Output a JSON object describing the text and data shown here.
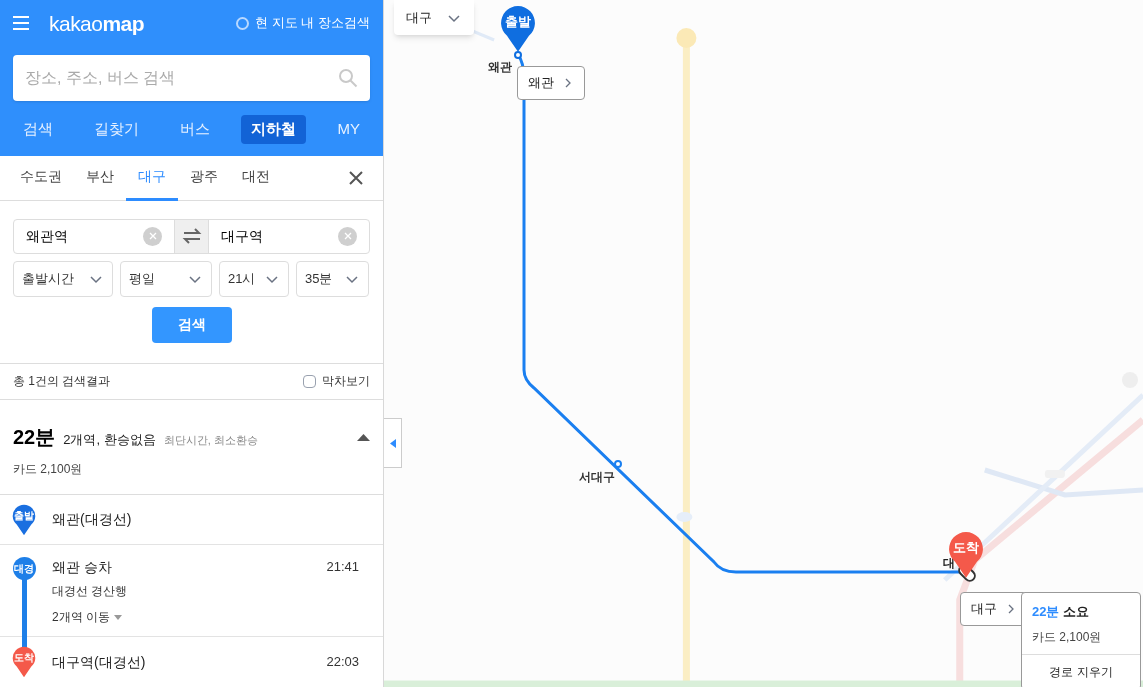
{
  "header": {
    "logo": {
      "light": "kakao",
      "bold": "map"
    },
    "map_search": {
      "label": "현 지도 내 장소검색",
      "checked": false
    }
  },
  "search": {
    "placeholder": "장소, 주소, 버스 검색"
  },
  "nav_tabs": [
    {
      "label": "검색",
      "selected": false
    },
    {
      "label": "길찾기",
      "selected": false
    },
    {
      "label": "버스",
      "selected": false
    },
    {
      "label": "지하철",
      "selected": true
    },
    {
      "label": "MY",
      "selected": false
    }
  ],
  "region_tabs": [
    {
      "label": "수도권",
      "selected": false
    },
    {
      "label": "부산",
      "selected": false
    },
    {
      "label": "대구",
      "selected": true
    },
    {
      "label": "광주",
      "selected": false
    },
    {
      "label": "대전",
      "selected": false
    }
  ],
  "route_form": {
    "origin": "왜관역",
    "destination": "대구역",
    "selects": [
      "출발시간",
      "평일",
      "21시",
      "35분"
    ],
    "search_button": "검색"
  },
  "results": {
    "count": "총 1건의 검색결과",
    "last_train": {
      "label": "막차보기",
      "checked": false
    }
  },
  "route": {
    "duration": "22분",
    "summary": "2개역, 환승없음",
    "tags": "최단시간, 최소환승",
    "fare": "카드 2,100원",
    "expanded": true
  },
  "steps": [
    {
      "kind": "start",
      "badge": "출발",
      "name": "왜관(대경선)"
    },
    {
      "kind": "ride",
      "badge": "대경",
      "name": "왜관 승차",
      "time": "21:41",
      "detail": "대경선 경산행",
      "stops": "2개역 이동"
    },
    {
      "kind": "end",
      "badge": "도착",
      "name": "대구역(대경선)",
      "time": "22:03"
    }
  ],
  "map": {
    "region_select": "대구",
    "start_marker": "출발",
    "end_marker": "도착",
    "station_labels": [
      "왜관",
      "서대구",
      "대"
    ],
    "origin_callout": "왜관",
    "destination_callout": "대구",
    "popup": {
      "duration": "22분",
      "suffix": "소요",
      "fare": "카드 2,100원",
      "action": "경로 지우기"
    }
  }
}
